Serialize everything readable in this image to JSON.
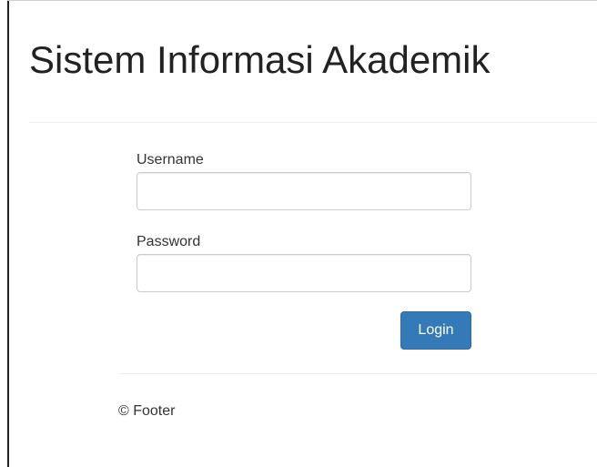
{
  "header": {
    "title": "Sistem Informasi Akademik"
  },
  "login_form": {
    "username_label": "Username",
    "username_value": "",
    "password_label": "Password",
    "password_value": "",
    "login_label": "Login",
    "accent_color": "#337ab7"
  },
  "footer": {
    "text": "© Footer"
  }
}
